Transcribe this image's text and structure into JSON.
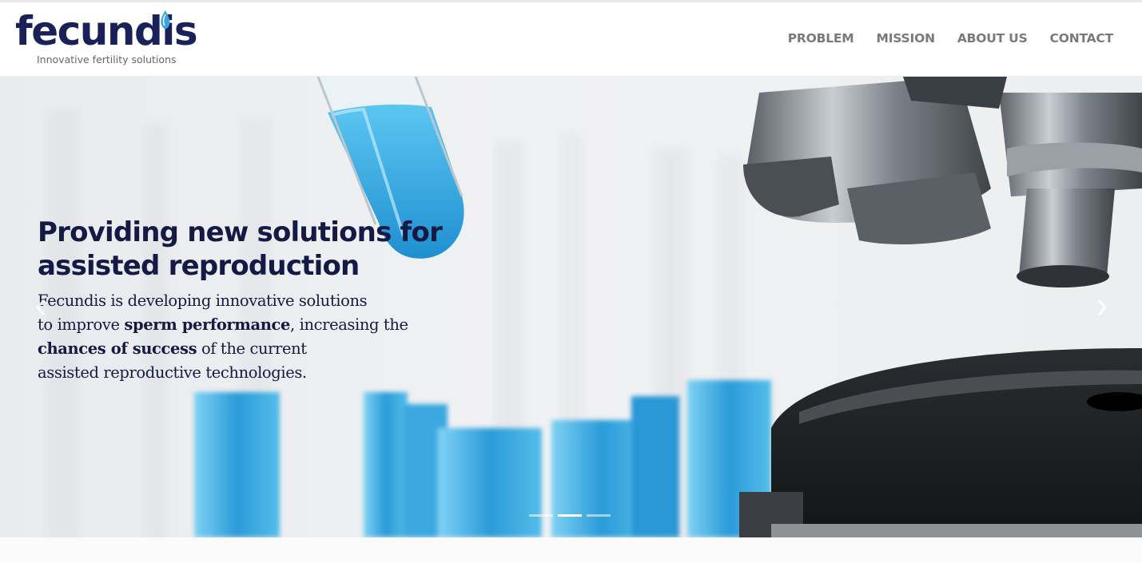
{
  "brand": {
    "name": "fecundis",
    "tagline": "Innovative fertility solutions",
    "color": "#182158",
    "accent": "#3aa5d8"
  },
  "nav": {
    "items": [
      {
        "label": "PROBLEM"
      },
      {
        "label": "MISSION"
      },
      {
        "label": "ABOUT US"
      },
      {
        "label": "CONTACT"
      }
    ]
  },
  "hero": {
    "title_line1": "Providing new solutions for",
    "title_line2": "assisted reproduction",
    "text": {
      "line1": "Fecundis is developing innovative solutions",
      "line2_a": "to improve ",
      "line2_b": "sperm performance",
      "line2_c": ", increasing the",
      "line3_a": "chances of success",
      "line3_b": " of the current",
      "line4": "assisted reproductive technologies."
    },
    "prev_icon": "chevron-left-icon",
    "next_icon": "chevron-right-icon",
    "slides": 3,
    "active_slide": 2
  }
}
